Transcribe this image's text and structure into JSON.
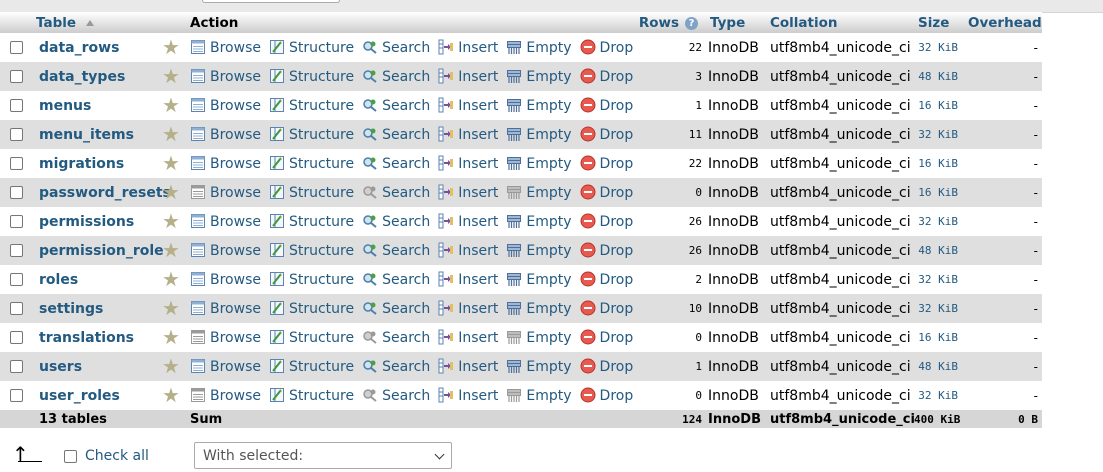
{
  "header": {
    "table": "Table",
    "action": "Action",
    "rows": "Rows",
    "type": "Type",
    "collation": "Collation",
    "size": "Size",
    "overhead": "Overhead"
  },
  "actions": {
    "browse": "Browse",
    "structure": "Structure",
    "search": "Search",
    "insert": "Insert",
    "empty": "Empty",
    "drop": "Drop"
  },
  "tables": [
    {
      "name": "data_rows",
      "rows": "22",
      "type": "InnoDB",
      "collation": "utf8mb4_unicode_ci",
      "size": "32 KiB",
      "overhead": "-",
      "empty": false
    },
    {
      "name": "data_types",
      "rows": "3",
      "type": "InnoDB",
      "collation": "utf8mb4_unicode_ci",
      "size": "48 KiB",
      "overhead": "-",
      "empty": false
    },
    {
      "name": "menus",
      "rows": "1",
      "type": "InnoDB",
      "collation": "utf8mb4_unicode_ci",
      "size": "16 KiB",
      "overhead": "-",
      "empty": false
    },
    {
      "name": "menu_items",
      "rows": "11",
      "type": "InnoDB",
      "collation": "utf8mb4_unicode_ci",
      "size": "32 KiB",
      "overhead": "-",
      "empty": false
    },
    {
      "name": "migrations",
      "rows": "22",
      "type": "InnoDB",
      "collation": "utf8mb4_unicode_ci",
      "size": "16 KiB",
      "overhead": "-",
      "empty": false
    },
    {
      "name": "password_resets",
      "rows": "0",
      "type": "InnoDB",
      "collation": "utf8mb4_unicode_ci",
      "size": "16 KiB",
      "overhead": "-",
      "empty": true
    },
    {
      "name": "permissions",
      "rows": "26",
      "type": "InnoDB",
      "collation": "utf8mb4_unicode_ci",
      "size": "32 KiB",
      "overhead": "-",
      "empty": false
    },
    {
      "name": "permission_role",
      "rows": "26",
      "type": "InnoDB",
      "collation": "utf8mb4_unicode_ci",
      "size": "48 KiB",
      "overhead": "-",
      "empty": false
    },
    {
      "name": "roles",
      "rows": "2",
      "type": "InnoDB",
      "collation": "utf8mb4_unicode_ci",
      "size": "32 KiB",
      "overhead": "-",
      "empty": false
    },
    {
      "name": "settings",
      "rows": "10",
      "type": "InnoDB",
      "collation": "utf8mb4_unicode_ci",
      "size": "32 KiB",
      "overhead": "-",
      "empty": false
    },
    {
      "name": "translations",
      "rows": "0",
      "type": "InnoDB",
      "collation": "utf8mb4_unicode_ci",
      "size": "16 KiB",
      "overhead": "-",
      "empty": true
    },
    {
      "name": "users",
      "rows": "1",
      "type": "InnoDB",
      "collation": "utf8mb4_unicode_ci",
      "size": "48 KiB",
      "overhead": "-",
      "empty": false
    },
    {
      "name": "user_roles",
      "rows": "0",
      "type": "InnoDB",
      "collation": "utf8mb4_unicode_ci",
      "size": "32 KiB",
      "overhead": "-",
      "empty": true
    }
  ],
  "summary": {
    "count": "13 tables",
    "label": "Sum",
    "rows": "124",
    "type": "InnoDB",
    "collation": "utf8mb4_unicode_ci",
    "size": "400 KiB",
    "overhead": "0 B"
  },
  "footer": {
    "check_all": "Check all",
    "with_selected": "With selected:"
  },
  "icons": {
    "favorite": "star-icon",
    "browse": "browse-icon",
    "structure": "structure-icon",
    "search": "search-icon",
    "insert": "insert-icon",
    "empty": "empty-icon",
    "drop": "drop-icon"
  },
  "colors": {
    "link": "#235a81",
    "drop": "#e85a4f",
    "even_row": "#dfdfdf"
  }
}
